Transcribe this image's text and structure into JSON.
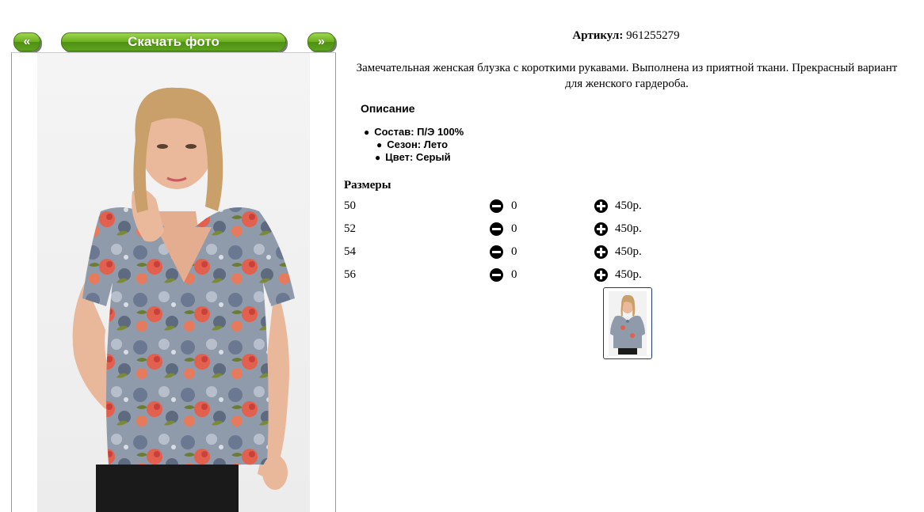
{
  "nav": {
    "prev_label": "«",
    "download_label": "Скачать фото",
    "next_label": "»"
  },
  "product": {
    "article_label": "Артикул:",
    "article_value": "961255279",
    "description": "Замечательная женская блузка с короткими рукавами. Выполнена из приятной ткани. Прекрасный вариант для женского гардероба.",
    "description_title": "Описание",
    "properties": [
      "Состав: П/Э 100%",
      "Сезон: Лето",
      "Цвет: Серый"
    ]
  },
  "sizes": {
    "title": "Размеры",
    "rows": [
      {
        "size": "50",
        "qty": "0",
        "price": "450р."
      },
      {
        "size": "52",
        "qty": "0",
        "price": "450р."
      },
      {
        "size": "54",
        "qty": "0",
        "price": "450р."
      },
      {
        "size": "56",
        "qty": "0",
        "price": "450р."
      }
    ]
  },
  "colors": {
    "button_green": "#6cb121",
    "thumb_border": "#1e3b6e"
  }
}
